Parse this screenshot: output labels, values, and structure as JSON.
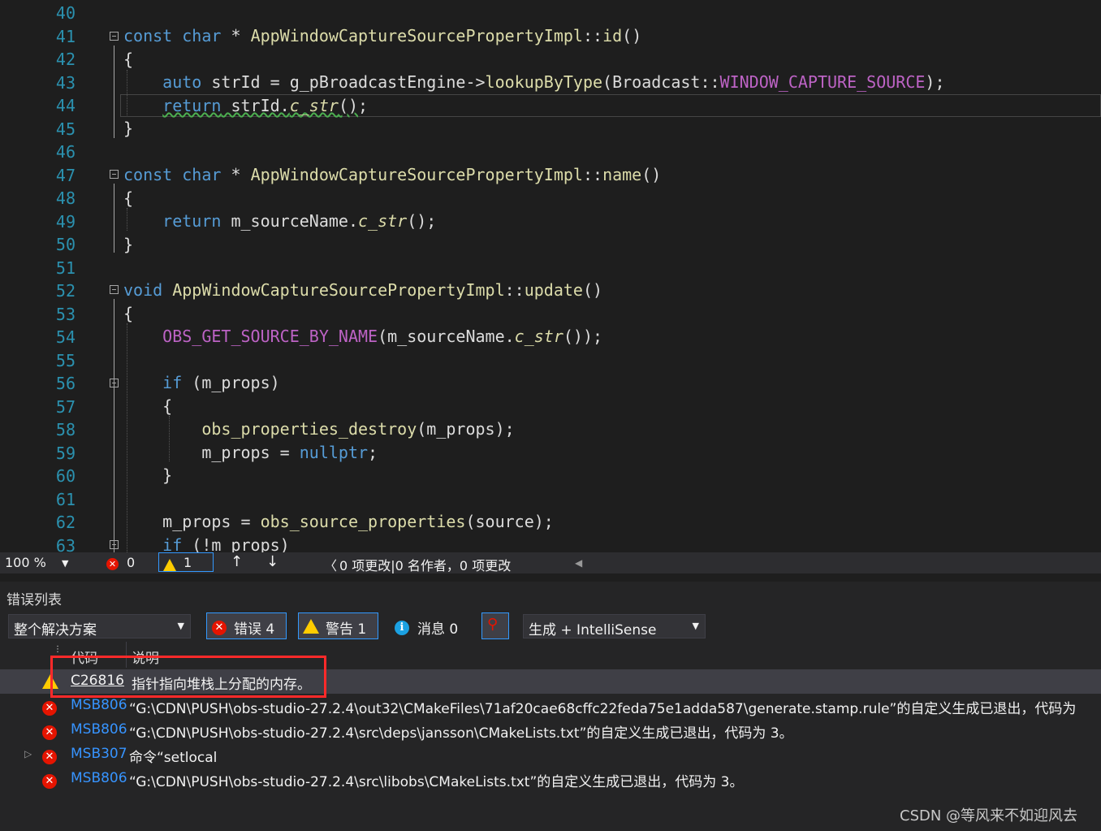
{
  "editor": {
    "line_numbers": [
      "40",
      "41",
      "42",
      "43",
      "44",
      "45",
      "46",
      "47",
      "48",
      "49",
      "50",
      "51",
      "52",
      "53",
      "54",
      "55",
      "56",
      "57",
      "58",
      "59",
      "60",
      "61",
      "62",
      "63"
    ]
  },
  "status": {
    "zoom": "100 %",
    "errors": "0",
    "warnings": "1",
    "changes": "0 项更改|0 名作者，0 项更改"
  },
  "error_list": {
    "title": "错误列表",
    "scope": "整个解决方案",
    "errors_btn": "错误 4",
    "warnings_btn": "警告 1",
    "messages_btn": "消息 0",
    "source": "生成 + IntelliSense",
    "col_code": "代码",
    "col_desc": "说明",
    "rows": [
      {
        "code": "C26816",
        "desc": "指针指向堆栈上分配的内存。",
        "kind": "warning"
      },
      {
        "code": "MSB806",
        "desc": "“G:\\CDN\\PUSH\\obs-studio-27.2.4\\out32\\CMakeFiles\\71af20cae68cffc22feda75e1adda587\\generate.stamp.rule”的自定义生成已退出，代码为",
        "kind": "error"
      },
      {
        "code": "MSB806",
        "desc": "“G:\\CDN\\PUSH\\obs-studio-27.2.4\\src\\deps\\jansson\\CMakeLists.txt”的自定义生成已退出，代码为 3。",
        "kind": "error"
      },
      {
        "code": "MSB307",
        "desc": "命令“setlocal",
        "kind": "error"
      },
      {
        "code": "MSB806",
        "desc": "“G:\\CDN\\PUSH\\obs-studio-27.2.4\\src\\libobs\\CMakeLists.txt”的自定义生成已退出，代码为 3。",
        "kind": "error"
      }
    ]
  },
  "watermark": "CSDN @等风来不如迎风去",
  "colors": {
    "highlight_box": "#ff2a2a",
    "error": "#e51400",
    "warning": "#ffcc00",
    "link": "#3794ff"
  }
}
